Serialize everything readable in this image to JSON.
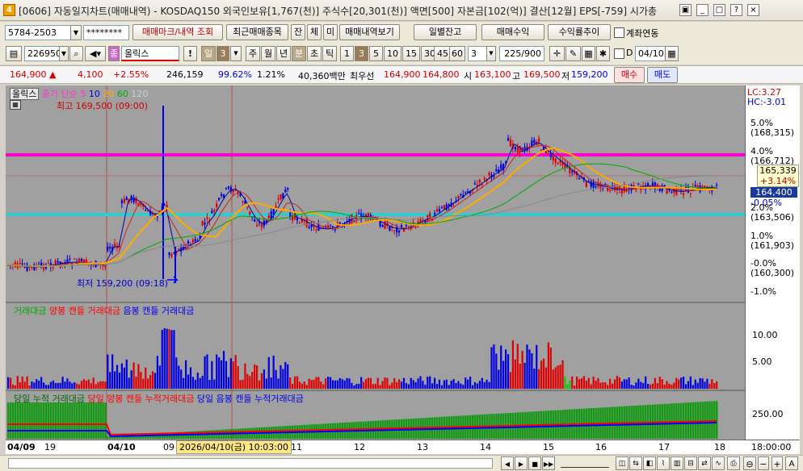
{
  "window": {
    "number_badge": "4",
    "title": "[0606] 자동일지차트(매매내역) - KOSDAQ150 외국인보유[1,767(천)] 주식수[20,301(천)] 액면[500] 자본금[102(억)] 결산[12월] EPS[-759] 시가총",
    "controls": [
      "restore-icon",
      "minimize-icon",
      "maximize-icon",
      "help-icon",
      "close-icon"
    ]
  },
  "toolbar1": {
    "account": "5784-2503",
    "password": "********",
    "btn_mark": "매매마크/내역 조회",
    "btn_recent": "최근매매종목",
    "btn_jan": "잔",
    "btn_che": "체",
    "btn_mi": "미",
    "btn_history": "매매내역보기",
    "btn_daily_balance": "일별잔고",
    "btn_trade_profit": "매매수익",
    "btn_profit_trend": "수익률추이",
    "chk_account_link": "계좌연동"
  },
  "toolbar2": {
    "code": "226950",
    "name": "올릭스",
    "name_badge": "종",
    "period_label": "일",
    "period_value": "3",
    "periods": [
      "주",
      "월",
      "년",
      "분",
      "초",
      "틱"
    ],
    "selected_period": "분",
    "minutes": [
      "1",
      "3",
      "5",
      "10",
      "15",
      "30",
      "45",
      "60"
    ],
    "selected_minute": "3",
    "interval_value": "3",
    "count": "225/900",
    "chk_d": "D",
    "date": "04/10"
  },
  "quote": {
    "price": "164,900",
    "change": "4,100",
    "change_pct": "+2.55%",
    "volume": "246,159",
    "strength": "99.62%",
    "turnover": "1.21%",
    "amount": "40,360백만",
    "best_label": "최우선",
    "best_ask": "164,900",
    "best_bid": "164,800",
    "open_label": "시",
    "open": "163,100",
    "high_label": "고",
    "high": "169,500",
    "low_label": "저",
    "low": "159,200",
    "buy": "매수",
    "sell": "매도"
  },
  "chart_data": {
    "type": "candlestick",
    "panels": [
      {
        "name": "price",
        "legend_title": "올릭스",
        "legend_series": [
          "종가 단순 5",
          "10",
          "20",
          "60",
          "120"
        ],
        "annotations": [
          "최고 169,500 (09:00)",
          "최저 159,200 (09:18)"
        ],
        "ylabels": [
          "5.0%",
          "(168,315)",
          "4.0%",
          "(166,712)",
          "2.0%",
          "(163,506)",
          "1.0%",
          "(161,903)",
          "-0.0%",
          "(160,300)",
          "-1.0%"
        ],
        "top_labels": [
          "LC:3.27",
          "HC:-3.01"
        ],
        "price_box": [
          "165,339",
          "+3.14%"
        ],
        "current_box": [
          "164,400",
          "-0.05%"
        ]
      },
      {
        "name": "volume",
        "legend": [
          "거래대금",
          "양봉 캔들 거래대금",
          "음봉 캔들 거래대금"
        ],
        "ylabels": [
          "10.00",
          "5.00"
        ]
      },
      {
        "name": "cumulative",
        "legend": [
          "당일 누적 거래대금",
          "당일 양봉 캔들 누적거래대금",
          "당일 음봉 캔들 누적거래대금"
        ],
        "ylabels": [
          "250.00"
        ]
      }
    ],
    "x_ticks": [
      "04/09",
      "19",
      "04/10",
      "09",
      "11",
      "12",
      "13",
      "14",
      "15",
      "16",
      "17",
      "18",
      "18:00:00"
    ],
    "cursor_label": "2026/04/10(금) 10:03:00"
  },
  "colors": {
    "pink_line": "#ff00cc",
    "cyan_line": "#33cccc",
    "up": "#e00000",
    "down": "#0000e0",
    "ma5": "#0000aa",
    "ma10": "#cc2222",
    "ma20": "#ffaa00",
    "ma60": "#00aa00",
    "ma120": "#888888"
  }
}
